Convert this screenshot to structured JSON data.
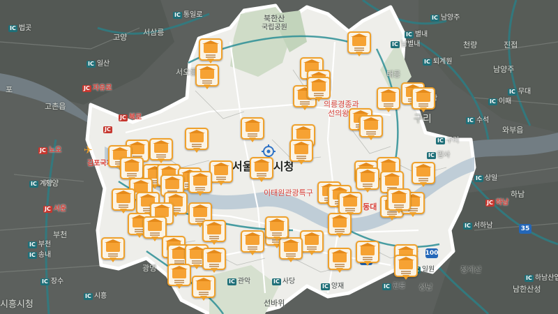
{
  "map": {
    "labels": [
      {
        "id": "bukhansan",
        "text": "북한산",
        "tone": "dark"
      },
      {
        "id": "national-park",
        "text": "국립공원",
        "tone": "dark"
      },
      {
        "id": "goyang",
        "text": "고양",
        "tone": "dim"
      },
      {
        "id": "seosamneung",
        "text": "서삼릉",
        "tone": "dim"
      },
      {
        "id": "seooreung",
        "text": "서오릉",
        "tone": "dim"
      },
      {
        "id": "gimpo-airport",
        "text": "김포국제공항",
        "tone": "red"
      },
      {
        "id": "po",
        "text": "포",
        "tone": "dim"
      },
      {
        "id": "gochon",
        "text": "고촌읍",
        "tone": "dim"
      },
      {
        "id": "gyeyang",
        "text": "계양",
        "tone": "dim"
      },
      {
        "id": "bucheon",
        "text": "부천",
        "tone": "dim"
      },
      {
        "id": "gwangmyeong",
        "text": "광명",
        "tone": "dim"
      },
      {
        "id": "siheung-city",
        "text": "시흥시청",
        "tone": "dim"
      },
      {
        "id": "seoul-city",
        "text": "서울특별시청",
        "tone": "big"
      },
      {
        "id": "itaewon",
        "text": "이태원관광특구",
        "tone": "red"
      },
      {
        "id": "yeongdongdae",
        "text": "영동대",
        "tone": "red"
      },
      {
        "id": "uireung",
        "text": "의릉경종과",
        "tone": "red"
      },
      {
        "id": "seonuireung",
        "text": "선의왕후",
        "tone": "red"
      },
      {
        "id": "taereung",
        "text": "태릉",
        "tone": "dim"
      },
      {
        "id": "guri",
        "text": "구리",
        "tone": "dim"
      },
      {
        "id": "namyangju",
        "text": "남양주",
        "tone": "dim"
      },
      {
        "id": "wabueup",
        "text": "와부읍",
        "tone": "dim"
      },
      {
        "id": "hanam",
        "text": "하남",
        "tone": "dim"
      },
      {
        "id": "cheongnyang",
        "text": "천량",
        "tone": "dim"
      },
      {
        "id": "jinjeop",
        "text": "진접",
        "tone": "dim"
      },
      {
        "id": "junggye",
        "text": "중량",
        "tone": "dim"
      },
      {
        "id": "namhansanseong",
        "text": "남한산성",
        "tone": "dim"
      },
      {
        "id": "cheongyesan",
        "text": "청계산",
        "tone": "dark"
      },
      {
        "id": "seongnam",
        "text": "성남",
        "tone": "dark"
      },
      {
        "id": "seonbawi",
        "text": "선바위",
        "tone": "dark"
      },
      {
        "id": "gwanak",
        "text": "관악",
        "tone": "dark"
      },
      {
        "id": "sadang",
        "text": "사당",
        "tone": "dark"
      },
      {
        "id": "yangjae",
        "text": "양재",
        "tone": "dark"
      },
      {
        "id": "heolleung",
        "text": "헌릉",
        "tone": "dark"
      },
      {
        "id": "jangsu",
        "text": "장수",
        "tone": "dim"
      },
      {
        "id": "songnae",
        "text": "송내",
        "tone": "dim"
      }
    ],
    "ics": [
      {
        "id": "tongil",
        "tag": "IC",
        "name": "통일로",
        "tone": "dim"
      },
      {
        "id": "beopgot",
        "tag": "IC",
        "name": "법곳",
        "tone": "dim"
      },
      {
        "id": "ilsan",
        "tag": "IC",
        "name": "일산",
        "tone": "dim"
      },
      {
        "id": "jayuro",
        "tag": "JC",
        "name": "자유로",
        "tone": "red"
      },
      {
        "id": "bukno",
        "tag": "JC",
        "name": "북로",
        "tone": "red"
      },
      {
        "id": "gimpo-jc",
        "tag": "JC",
        "name": "",
        "tone": "red"
      },
      {
        "id": "noo",
        "tag": "JC",
        "name": "노오",
        "tone": "red"
      },
      {
        "id": "gyeyang-ic",
        "tag": "IC",
        "name": "계양",
        "tone": "dim"
      },
      {
        "id": "seoun",
        "tag": "JC",
        "name": "서운",
        "tone": "red"
      },
      {
        "id": "bucheon-ic",
        "tag": "IC",
        "name": "부천",
        "tone": "dim"
      },
      {
        "id": "songnae-ic",
        "tag": "IC",
        "name": "송내",
        "tone": "dim"
      },
      {
        "id": "jangsu-ic",
        "tag": "IC",
        "name": "장수",
        "tone": "dim"
      },
      {
        "id": "siheung-ic",
        "tag": "IC",
        "name": "시흥",
        "tone": "dim"
      },
      {
        "id": "gwanak-ic",
        "tag": "IC",
        "name": "관악",
        "tone": "dk"
      },
      {
        "id": "sadang-ic",
        "tag": "IC",
        "name": "사당",
        "tone": "dk"
      },
      {
        "id": "yangjae-ic",
        "tag": "IC",
        "name": "양재",
        "tone": "dk"
      },
      {
        "id": "heolleung-ic",
        "tag": "IC",
        "name": "헌릉",
        "tone": "dk"
      },
      {
        "id": "ilwon",
        "tag": "IC",
        "name": "일원",
        "tone": "dk"
      },
      {
        "id": "seohanam",
        "tag": "IC",
        "name": "서하남",
        "tone": "dim"
      },
      {
        "id": "hanam-jc",
        "tag": "JC",
        "name": "하남",
        "tone": "red"
      },
      {
        "id": "sangil",
        "tag": "IC",
        "name": "상일",
        "tone": "dim"
      },
      {
        "id": "amsa",
        "tag": "IC",
        "name": "암사",
        "tone": "dim"
      },
      {
        "id": "guri-jc",
        "tag": "IC",
        "name": "구리",
        "tone": "dim"
      },
      {
        "id": "suseok",
        "tag": "IC",
        "name": "수석",
        "tone": "dim"
      },
      {
        "id": "idae",
        "tag": "IC",
        "name": "이패",
        "tone": "dim"
      },
      {
        "id": "mudae",
        "tag": "IC",
        "name": "무대",
        "tone": "dim"
      },
      {
        "id": "toegyewon",
        "tag": "IC",
        "name": "퇴계원",
        "tone": "dim"
      },
      {
        "id": "namyangju-ic",
        "tag": "IC",
        "name": "남양주",
        "tone": "dim"
      },
      {
        "id": "byeollae",
        "tag": "IC",
        "name": "별내",
        "tone": "dim"
      },
      {
        "id": "namnaengbuk",
        "tag": "IC",
        "name": "남별내",
        "tone": "dim"
      },
      {
        "id": "jungnang",
        "tag": "IC",
        "name": "중랑",
        "tone": "dim"
      },
      {
        "id": "hanamsanup",
        "tag": "IC",
        "name": "하남산업",
        "tone": "dim"
      }
    ],
    "route_shields": [
      {
        "id": "route-100",
        "number": "100",
        "color": "#2467b8"
      },
      {
        "id": "route-47",
        "number": "47",
        "color": "#2467b8"
      },
      {
        "id": "route-35",
        "number": "35",
        "color": "#2467b8"
      }
    ],
    "marker_count": 64
  }
}
